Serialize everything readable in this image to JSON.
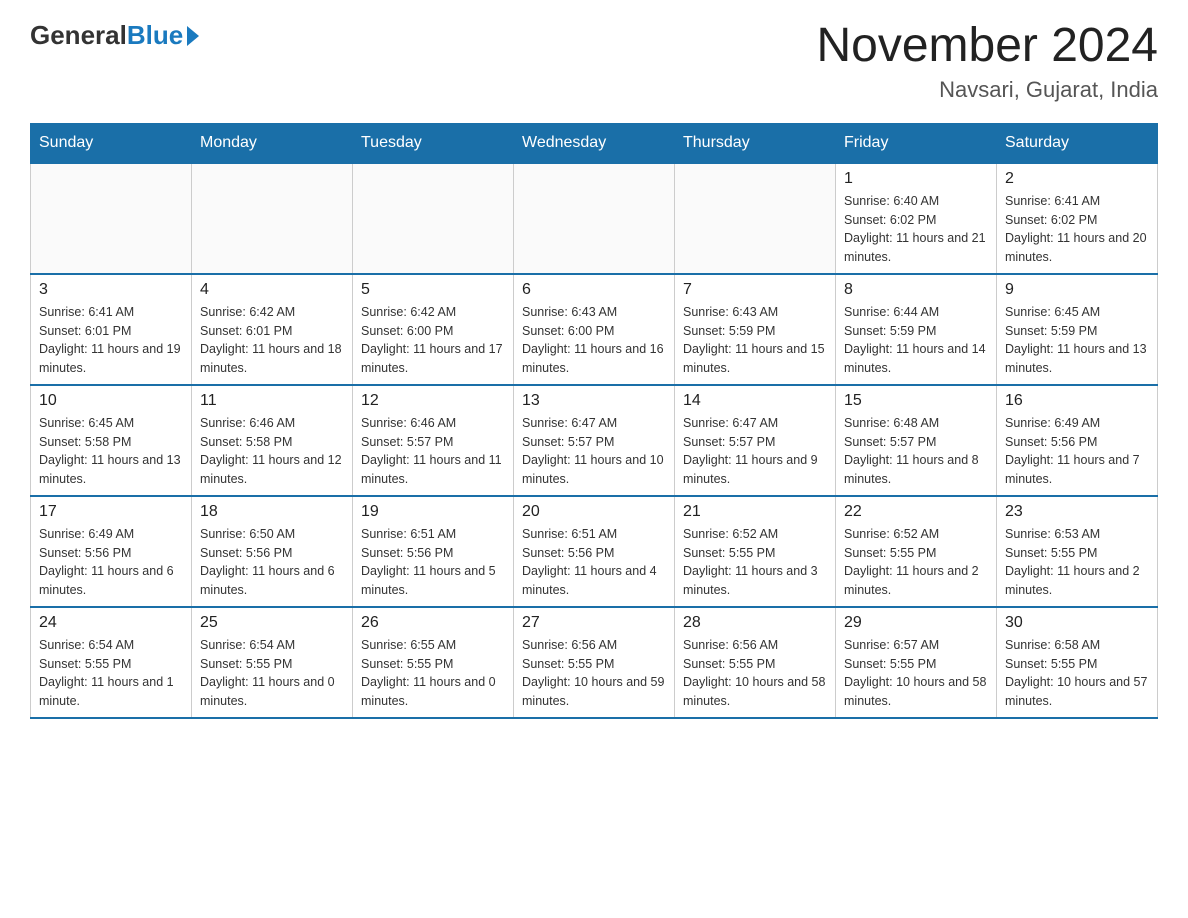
{
  "logo": {
    "general": "General",
    "blue": "Blue"
  },
  "title": "November 2024",
  "location": "Navsari, Gujarat, India",
  "days_of_week": [
    "Sunday",
    "Monday",
    "Tuesday",
    "Wednesday",
    "Thursday",
    "Friday",
    "Saturday"
  ],
  "weeks": [
    [
      {
        "day": "",
        "info": ""
      },
      {
        "day": "",
        "info": ""
      },
      {
        "day": "",
        "info": ""
      },
      {
        "day": "",
        "info": ""
      },
      {
        "day": "",
        "info": ""
      },
      {
        "day": "1",
        "info": "Sunrise: 6:40 AM\nSunset: 6:02 PM\nDaylight: 11 hours and 21 minutes."
      },
      {
        "day": "2",
        "info": "Sunrise: 6:41 AM\nSunset: 6:02 PM\nDaylight: 11 hours and 20 minutes."
      }
    ],
    [
      {
        "day": "3",
        "info": "Sunrise: 6:41 AM\nSunset: 6:01 PM\nDaylight: 11 hours and 19 minutes."
      },
      {
        "day": "4",
        "info": "Sunrise: 6:42 AM\nSunset: 6:01 PM\nDaylight: 11 hours and 18 minutes."
      },
      {
        "day": "5",
        "info": "Sunrise: 6:42 AM\nSunset: 6:00 PM\nDaylight: 11 hours and 17 minutes."
      },
      {
        "day": "6",
        "info": "Sunrise: 6:43 AM\nSunset: 6:00 PM\nDaylight: 11 hours and 16 minutes."
      },
      {
        "day": "7",
        "info": "Sunrise: 6:43 AM\nSunset: 5:59 PM\nDaylight: 11 hours and 15 minutes."
      },
      {
        "day": "8",
        "info": "Sunrise: 6:44 AM\nSunset: 5:59 PM\nDaylight: 11 hours and 14 minutes."
      },
      {
        "day": "9",
        "info": "Sunrise: 6:45 AM\nSunset: 5:59 PM\nDaylight: 11 hours and 13 minutes."
      }
    ],
    [
      {
        "day": "10",
        "info": "Sunrise: 6:45 AM\nSunset: 5:58 PM\nDaylight: 11 hours and 13 minutes."
      },
      {
        "day": "11",
        "info": "Sunrise: 6:46 AM\nSunset: 5:58 PM\nDaylight: 11 hours and 12 minutes."
      },
      {
        "day": "12",
        "info": "Sunrise: 6:46 AM\nSunset: 5:57 PM\nDaylight: 11 hours and 11 minutes."
      },
      {
        "day": "13",
        "info": "Sunrise: 6:47 AM\nSunset: 5:57 PM\nDaylight: 11 hours and 10 minutes."
      },
      {
        "day": "14",
        "info": "Sunrise: 6:47 AM\nSunset: 5:57 PM\nDaylight: 11 hours and 9 minutes."
      },
      {
        "day": "15",
        "info": "Sunrise: 6:48 AM\nSunset: 5:57 PM\nDaylight: 11 hours and 8 minutes."
      },
      {
        "day": "16",
        "info": "Sunrise: 6:49 AM\nSunset: 5:56 PM\nDaylight: 11 hours and 7 minutes."
      }
    ],
    [
      {
        "day": "17",
        "info": "Sunrise: 6:49 AM\nSunset: 5:56 PM\nDaylight: 11 hours and 6 minutes."
      },
      {
        "day": "18",
        "info": "Sunrise: 6:50 AM\nSunset: 5:56 PM\nDaylight: 11 hours and 6 minutes."
      },
      {
        "day": "19",
        "info": "Sunrise: 6:51 AM\nSunset: 5:56 PM\nDaylight: 11 hours and 5 minutes."
      },
      {
        "day": "20",
        "info": "Sunrise: 6:51 AM\nSunset: 5:56 PM\nDaylight: 11 hours and 4 minutes."
      },
      {
        "day": "21",
        "info": "Sunrise: 6:52 AM\nSunset: 5:55 PM\nDaylight: 11 hours and 3 minutes."
      },
      {
        "day": "22",
        "info": "Sunrise: 6:52 AM\nSunset: 5:55 PM\nDaylight: 11 hours and 2 minutes."
      },
      {
        "day": "23",
        "info": "Sunrise: 6:53 AM\nSunset: 5:55 PM\nDaylight: 11 hours and 2 minutes."
      }
    ],
    [
      {
        "day": "24",
        "info": "Sunrise: 6:54 AM\nSunset: 5:55 PM\nDaylight: 11 hours and 1 minute."
      },
      {
        "day": "25",
        "info": "Sunrise: 6:54 AM\nSunset: 5:55 PM\nDaylight: 11 hours and 0 minutes."
      },
      {
        "day": "26",
        "info": "Sunrise: 6:55 AM\nSunset: 5:55 PM\nDaylight: 11 hours and 0 minutes."
      },
      {
        "day": "27",
        "info": "Sunrise: 6:56 AM\nSunset: 5:55 PM\nDaylight: 10 hours and 59 minutes."
      },
      {
        "day": "28",
        "info": "Sunrise: 6:56 AM\nSunset: 5:55 PM\nDaylight: 10 hours and 58 minutes."
      },
      {
        "day": "29",
        "info": "Sunrise: 6:57 AM\nSunset: 5:55 PM\nDaylight: 10 hours and 58 minutes."
      },
      {
        "day": "30",
        "info": "Sunrise: 6:58 AM\nSunset: 5:55 PM\nDaylight: 10 hours and 57 minutes."
      }
    ]
  ]
}
